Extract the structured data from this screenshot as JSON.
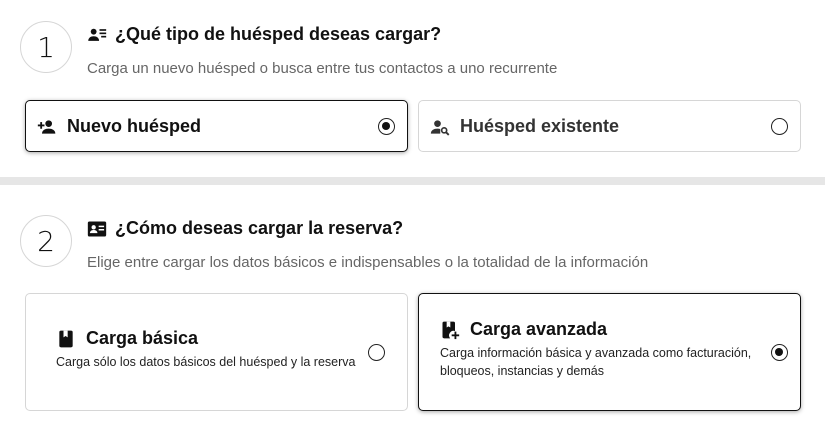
{
  "step1": {
    "number": "1",
    "title": "¿Qué tipo de huésped deseas cargar?",
    "subtitle": "Carga un nuevo huésped o busca entre tus contactos a uno recurrente",
    "title_icon": "person-list-icon",
    "options": [
      {
        "label": "Nuevo huésped",
        "icon": "person-add-icon",
        "selected": true
      },
      {
        "label": "Huésped existente",
        "icon": "person-search-icon",
        "selected": false
      }
    ]
  },
  "step2": {
    "number": "2",
    "title": "¿Cómo deseas cargar la reserva?",
    "subtitle": "Elige entre cargar los datos básicos e indispensables o la totalidad de la información",
    "title_icon": "contact-card-icon",
    "options": [
      {
        "label": "Carga básica",
        "description": "Carga sólo los datos básicos del huésped y la reserva",
        "icon": "book-icon",
        "selected": false
      },
      {
        "label": "Carga avanzada",
        "description": "Carga información básica y avanzada como facturación, bloqueos, instancias y demás",
        "icon": "book-add-icon",
        "selected": true
      }
    ]
  },
  "colors": {
    "border": "#d6d6d6",
    "selected_border": "#111111",
    "divider": "#e6e6e6",
    "muted_text": "#666666"
  }
}
